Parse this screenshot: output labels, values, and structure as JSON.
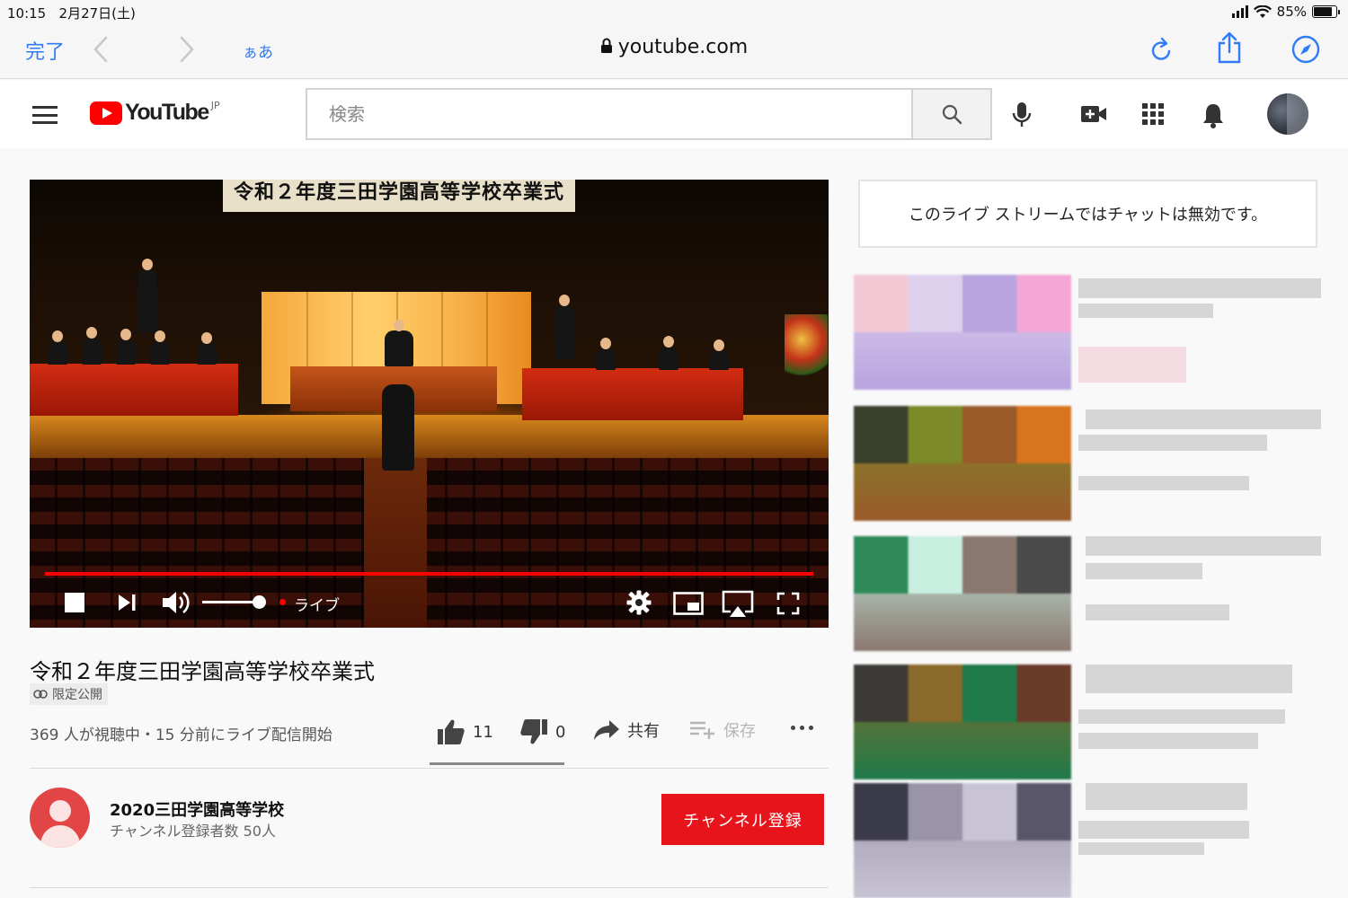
{
  "status_bar": {
    "time": "10:15",
    "date": "2月27日(土)",
    "battery": "85%",
    "battery_level": 0.85
  },
  "safari": {
    "done": "完了",
    "text_size": "ぁあ",
    "url": "youtube.com",
    "accent": "#2f7cf6"
  },
  "youtube": {
    "logo_text": "YouTube",
    "region": "JP",
    "search_placeholder": "検索",
    "brand_color": "#ff0000"
  },
  "player": {
    "banner": "令和２年度三田学園高等学校卒業式",
    "live_label": "ライブ",
    "volume_level": 0.85,
    "progress": 1.0
  },
  "video": {
    "title": "令和２年度三田学園高等学校卒業式",
    "privacy": "限定公開",
    "stats": "369 人が視聴中・15 分前にライブ配信開始",
    "likes": "11",
    "dislikes": "0",
    "share": "共有",
    "save": "保存"
  },
  "channel": {
    "name": "2020三田学園高等学校",
    "subscribers": "チャンネル登録者数 50人",
    "subscribe": "チャンネル登録"
  },
  "chat": {
    "message": "このライブ ストリームではチャットは無効です。"
  },
  "recommendations": [
    {
      "thumb_colors": [
        "#f2c8d4",
        "#ddd0ec",
        "#b9a4e0",
        "#f4a6d6"
      ]
    },
    {
      "thumb_colors": [
        "#39402c",
        "#7c8a2a",
        "#9a5a2a",
        "#d8741e"
      ]
    },
    {
      "thumb_colors": [
        "#2f8a58",
        "#c8efe0",
        "#8a7870",
        "#4a4a4a"
      ]
    },
    {
      "thumb_colors": [
        "#3c3a36",
        "#8a6a2a",
        "#1f7a4a",
        "#6a3a2a"
      ]
    },
    {
      "thumb_colors": [
        "#3a3a48",
        "#9a94a8",
        "#c8c4d4",
        "#5a566a"
      ]
    }
  ]
}
